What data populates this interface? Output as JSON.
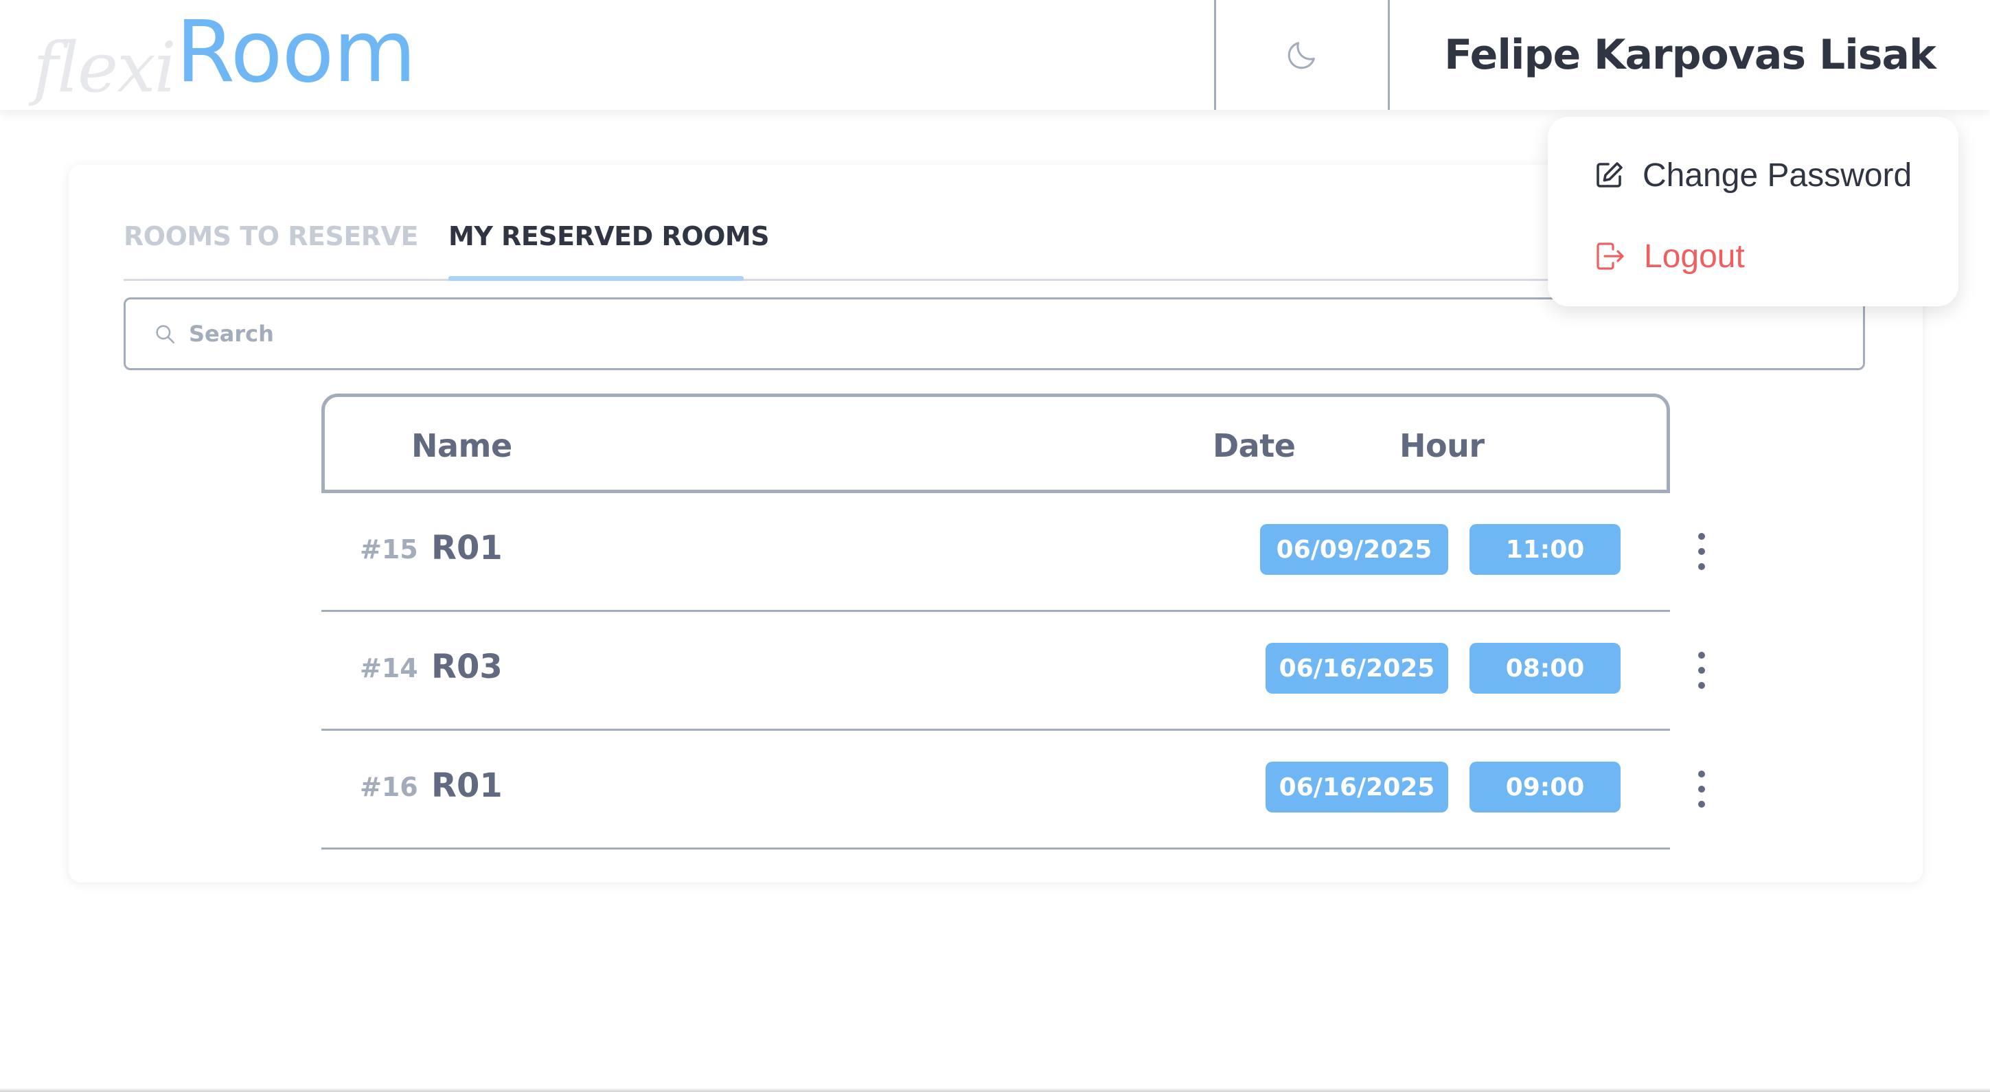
{
  "brand": {
    "script": "flexi",
    "word": "Room"
  },
  "header": {
    "theme_icon": "moon-icon",
    "user_name": "Felipe Karpovas Lisak"
  },
  "user_menu": {
    "change_password": {
      "label": "Change Password",
      "icon": "edit-icon"
    },
    "logout": {
      "label": "Logout",
      "icon": "logout-icon"
    }
  },
  "tabs": [
    {
      "label": "ROOMS TO RESERVE",
      "active": false
    },
    {
      "label": "MY RESERVED ROOMS",
      "active": true
    }
  ],
  "search": {
    "placeholder": "Search",
    "value": ""
  },
  "table": {
    "columns": {
      "name": "Name",
      "date": "Date",
      "hour": "Hour"
    },
    "rows": [
      {
        "id": "#15",
        "name": "R01",
        "date": "06/09/2025",
        "hour": "11:00"
      },
      {
        "id": "#14",
        "name": "R03",
        "date": "06/16/2025",
        "hour": "08:00"
      },
      {
        "id": "#16",
        "name": "R01",
        "date": "06/16/2025",
        "hour": "09:00"
      }
    ]
  },
  "colors": {
    "accent": "#6eb6f4",
    "danger": "#ef5f5f",
    "text": "#2f3542",
    "muted": "#a3acbb"
  }
}
